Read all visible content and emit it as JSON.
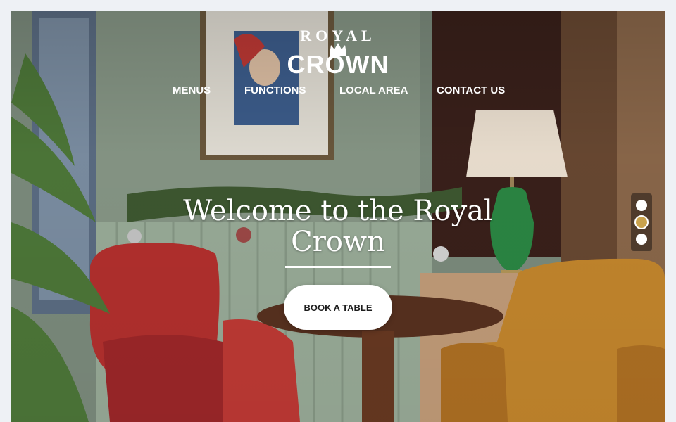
{
  "brand": {
    "logo_top": "ROYAL",
    "logo_bottom": "CROWN"
  },
  "nav": {
    "items": [
      {
        "label": "MENUS"
      },
      {
        "label": "FUNCTIONS"
      },
      {
        "label": "LOCAL AREA"
      },
      {
        "label": "CONTACT US"
      }
    ]
  },
  "hero": {
    "title": "Welcome to the Royal Crown",
    "cta_label": "BOOK A TABLE"
  },
  "slider": {
    "slide_count": 3,
    "active_index": 2
  },
  "colors": {
    "accent_gold": "#c9a24d",
    "wall_green": "#7d8c7e",
    "velvet_red": "#b8312f",
    "leather_tan": "#c98a2e"
  }
}
